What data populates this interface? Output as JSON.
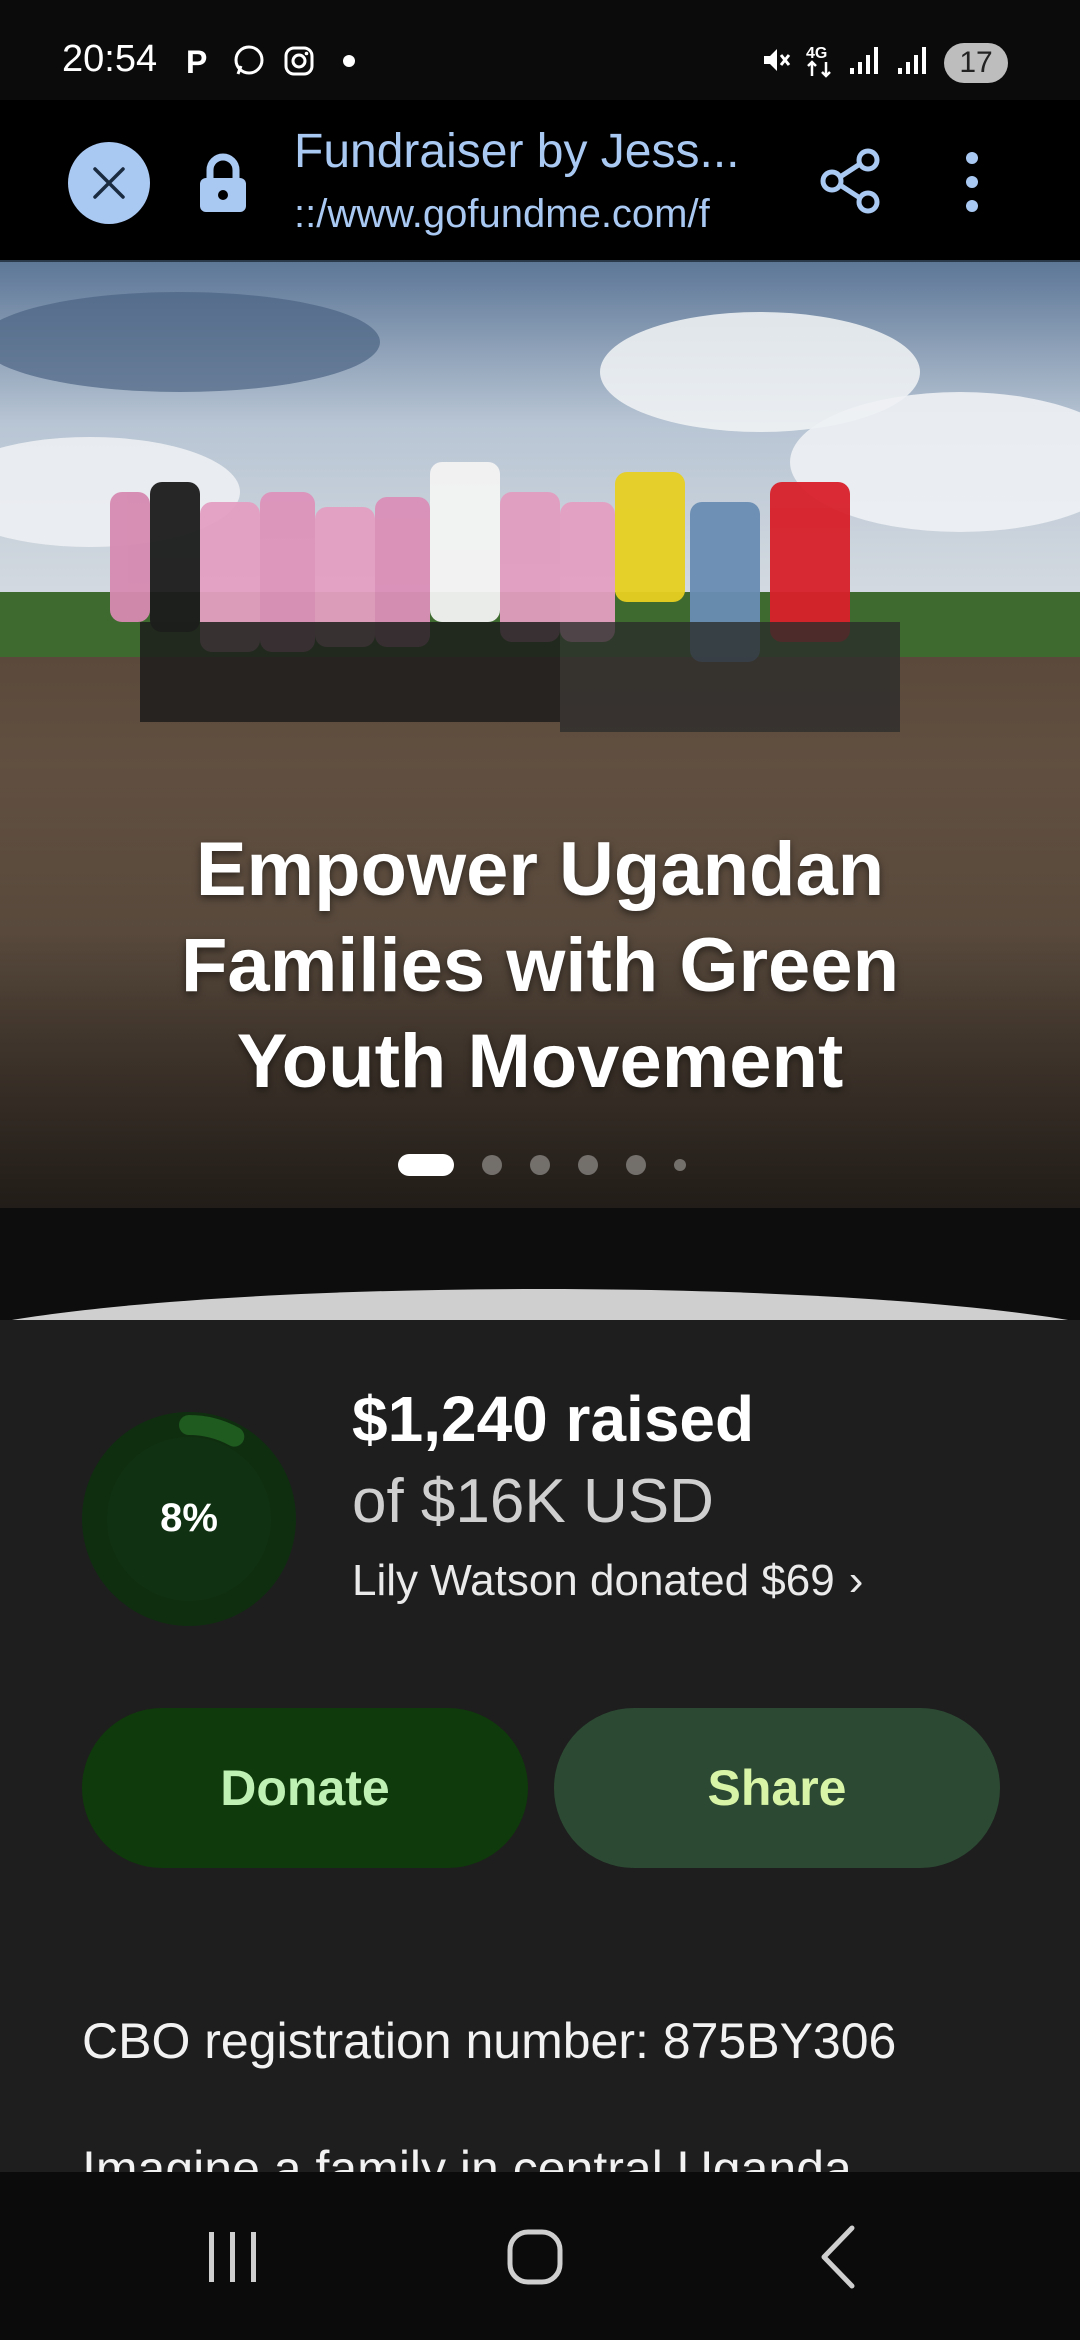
{
  "status_bar": {
    "time": "20:54",
    "left_icons": [
      "parking-p-icon",
      "whatsapp-icon",
      "instagram-icon",
      "notification-dot-icon"
    ],
    "right_icons": [
      "mute-icon",
      "4g-icon",
      "signal-icon",
      "signal-icon"
    ],
    "battery": "17"
  },
  "browser": {
    "title": "Fundraiser by Jess...",
    "url": "::/www.gofundme.com/f",
    "accent_color": "#a9c8f2"
  },
  "hero": {
    "title_line1": "Empower Ugandan",
    "title_line2": "Families with Green",
    "title_line3": "Youth Movement",
    "slides_total": 6,
    "slide_active": 1
  },
  "fundraiser": {
    "progress_label": "8%",
    "progress_value": 0.08,
    "raised": "$1,240 raised",
    "goal": "of $16K USD",
    "recent_donation": "Lily Watson donated $69",
    "chevron": "›"
  },
  "actions": {
    "donate_label": "Donate",
    "share_label": "Share"
  },
  "description": {
    "cbo": "CBO registration number: 875BY306",
    "intro_partial": "Imagine a family in central Uganda..."
  },
  "colors": {
    "donate_bg": "#0f3a0b",
    "share_bg": "#2c4a33",
    "content_bg": "#1e1e1e",
    "progress_track": "#123d12"
  }
}
